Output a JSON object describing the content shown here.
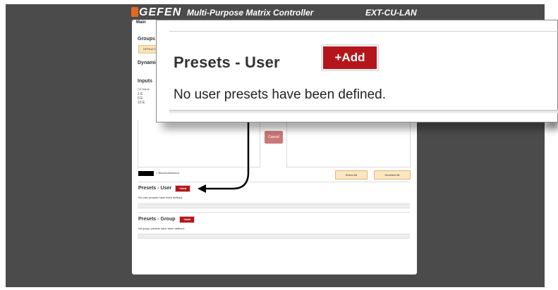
{
  "header": {
    "logo": "GEFEN",
    "app_title": "Multi-Purpose Matrix Controller",
    "device": "EXT-CU-LAN"
  },
  "tabs": {
    "main_label": "Main"
  },
  "groups": {
    "label": "Groups",
    "default_button": "DEFAULT"
  },
  "dynamic": {
    "label": "Dynamic"
  },
  "inputs": {
    "label": "Inputs",
    "header": "Ch   Name",
    "rows": [
      {
        "ch": "1",
        "name": "E"
      },
      {
        "ch": "5",
        "name": "E"
      },
      {
        "ch": "10",
        "name": "E"
      }
    ]
  },
  "controls": {
    "cancel_label": "Cancel",
    "blocked_label": "= Blocked/Masked",
    "select_all_label": "Select All",
    "deselect_all_label": "Deselect All"
  },
  "presets_user": {
    "title": "Presets - User",
    "add_label": "+Add",
    "empty_note": "No user presets have been defined."
  },
  "presets_group": {
    "title": "Presets - Group",
    "add_label": "+Add",
    "empty_note": "No group presets have been defined."
  },
  "colors": {
    "background_dark": "#4b4b4b",
    "accent_red": "#b5161b",
    "logo_orange": "#e2691d"
  }
}
